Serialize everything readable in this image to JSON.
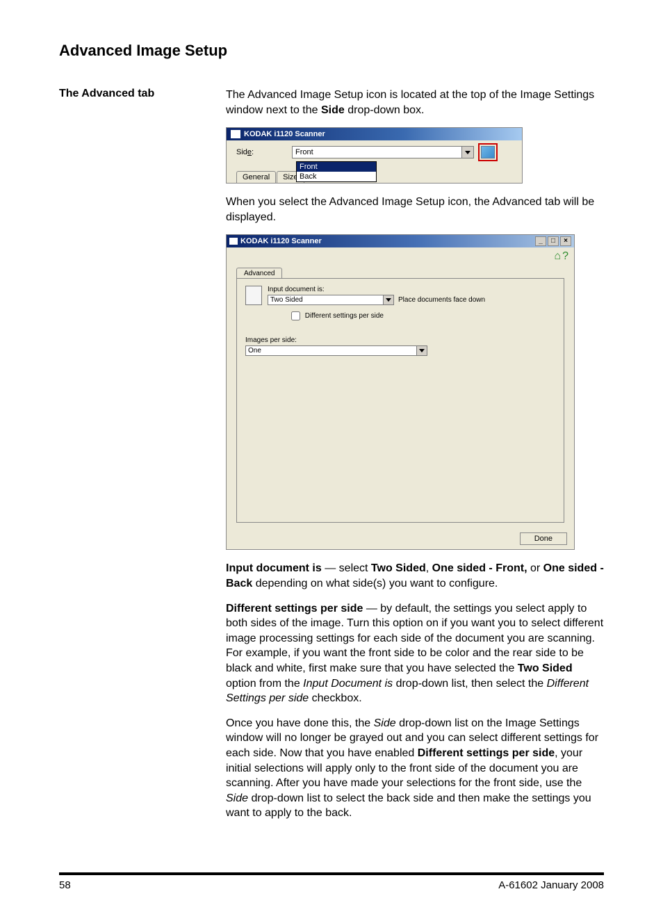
{
  "heading": "Advanced Image Setup",
  "sideHeading": "The Advanced tab",
  "intro": {
    "p1a": "The Advanced Image Setup icon is located at the top of the Image Settings window next to the ",
    "p1b": "Side",
    "p1c": " drop-down box."
  },
  "ss1": {
    "title": "KODAK i1120 Scanner",
    "sideLabel": "Side:",
    "sideLabelUnderline": "e",
    "ddValue": "Front",
    "ddOptions": [
      "Front",
      "Back"
    ],
    "tabs": [
      "General",
      "Size"
    ]
  },
  "midText": "When you select the Advanced Image Setup icon, the Advanced tab will be displayed.",
  "ss2": {
    "title": "KODAK i1120 Scanner",
    "tab": "Advanced",
    "inputDocLabel": "Input document is:",
    "inputDocValue": "Two Sided",
    "placeNote": "Place documents face down",
    "diffLabel": "Different settings per side",
    "ipsLabel": "Images per side:",
    "ipsValue": "One",
    "done": "Done"
  },
  "body": {
    "p1": {
      "b1": "Input document is",
      "t1": " — select ",
      "b2": "Two Sided",
      "t2": ", ",
      "b3": "One sided - Front,",
      "t3": " or ",
      "b4": "One sided - Back",
      "t4": " depending on what side(s) you want to configure."
    },
    "p2": {
      "b1": "Different settings per side",
      "t1": " — by default, the settings you select apply to both sides of the image. Turn this option on if you want you to select different image processing settings for each side of the document you are scanning. For example, if you want the front side to be color and the rear side to be black and white, first make sure that you have selected the ",
      "b2": "Two Sided",
      "t2": " option from the ",
      "i1": "Input Document is",
      "t3": " drop-down list, then select the ",
      "i2": "Different Settings per side",
      "t4": " checkbox."
    },
    "p3": {
      "t1": "Once you have done this, the ",
      "i1": "Side",
      "t2": " drop-down list on the Image Settings window will no longer be grayed out and you can select different settings for each side. Now that you have enabled ",
      "b1": "Different settings per side",
      "t3": ", your initial selections will apply only to the front side of the document you are scanning. After you have made your selections for the front side, use the ",
      "i2": "Side",
      "t4": " drop-down list to select the back side and then make the settings you want to apply to the back."
    }
  },
  "footer": {
    "pageNum": "58",
    "docId": "A-61602  January 2008"
  }
}
